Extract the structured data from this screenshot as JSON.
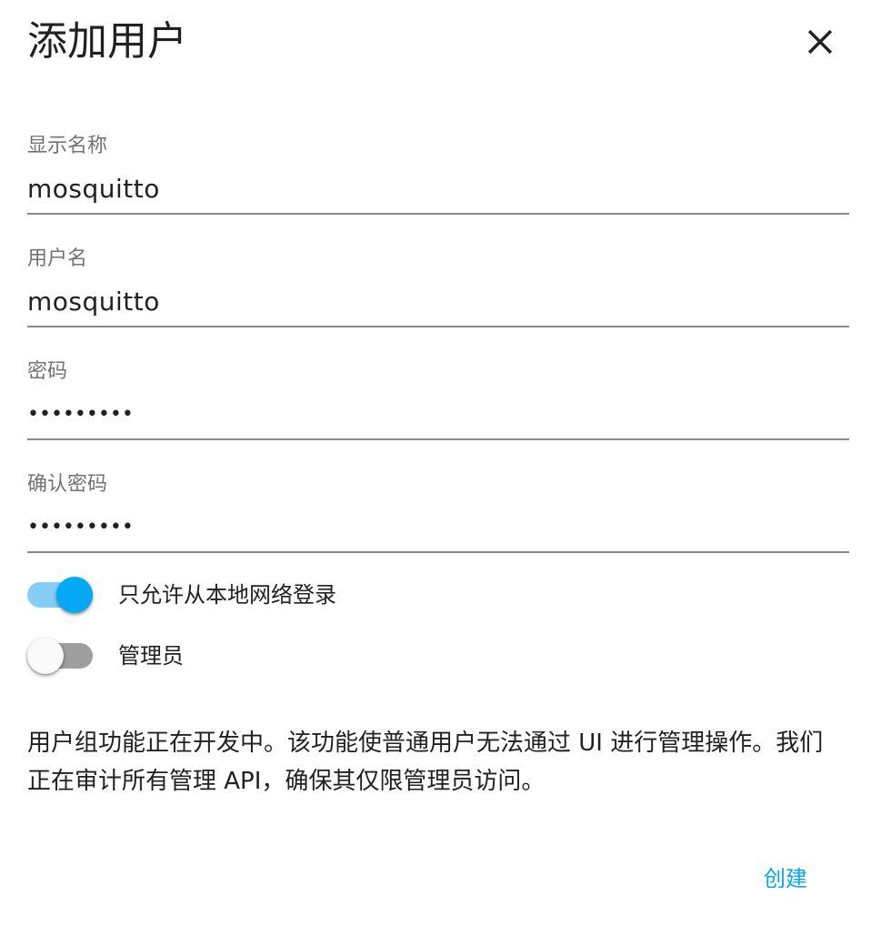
{
  "dialog": {
    "title": "添加用户",
    "close_icon": "close-icon"
  },
  "fields": {
    "display_name": {
      "label": "显示名称",
      "value": "mosquitto"
    },
    "username": {
      "label": "用户名",
      "value": "mosquitto"
    },
    "password": {
      "label": "密码",
      "value": "mosquitto"
    },
    "confirm_password": {
      "label": "确认密码",
      "value": "mosquitto"
    }
  },
  "switches": {
    "local_only": {
      "label": "只允许从本地网络登录",
      "checked": true
    },
    "admin": {
      "label": "管理员",
      "checked": false
    }
  },
  "info": {
    "text": "用户组功能正在开发中。该功能使普通用户无法通过 UI 进行管理操作。我们正在审计所有管理 API，确保其仅限管理员访问。"
  },
  "actions": {
    "create_label": "创建"
  },
  "colors": {
    "accent": "#03a9f4",
    "accent_track": "#86cdf5",
    "off_track": "#9e9e9e",
    "label_text": "#727272",
    "text": "#212121"
  }
}
